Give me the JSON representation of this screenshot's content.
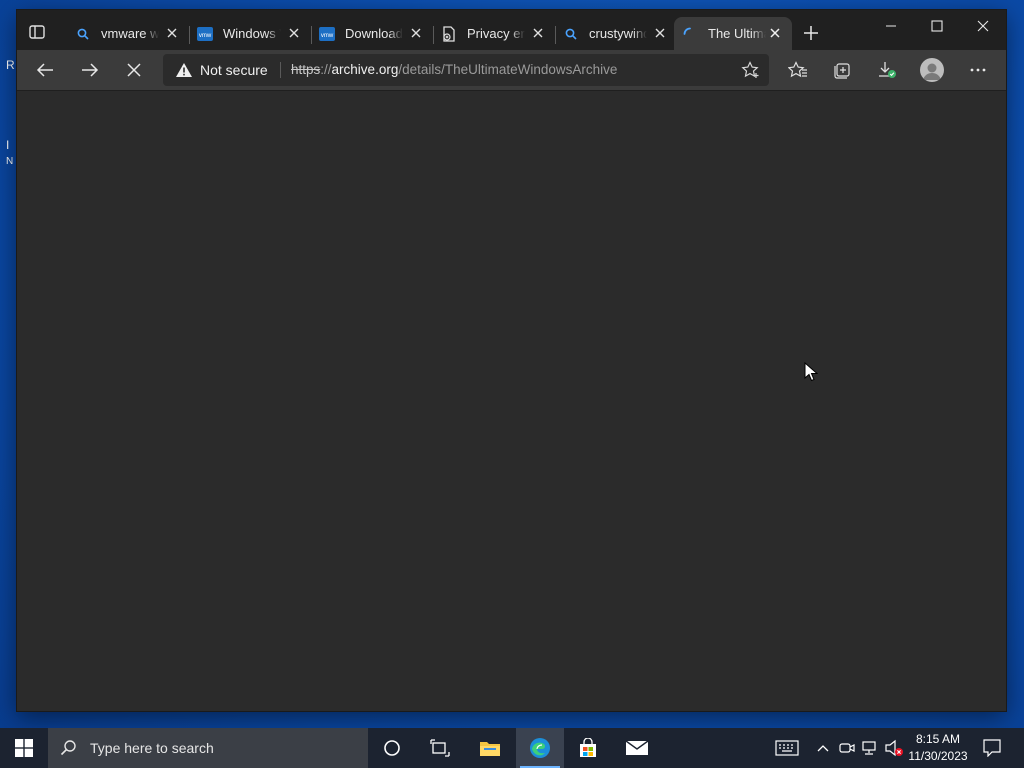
{
  "desktop": {
    "edge_letters": [
      "R",
      "I",
      "N"
    ]
  },
  "browser": {
    "tabs": [
      {
        "title": "vmware w",
        "favicon": "search-icon"
      },
      {
        "title": "Windows V",
        "favicon": "vmware-icon"
      },
      {
        "title": "Download",
        "favicon": "vmware-icon"
      },
      {
        "title": "Privacy err",
        "favicon": "privacy-error-icon"
      },
      {
        "title": "crustywind",
        "favicon": "search-icon"
      },
      {
        "title": "The Ultima",
        "favicon": "loading-spinner-icon"
      }
    ],
    "active_tab_index": 5,
    "address": {
      "security_label": "Not secure",
      "scheme": "https",
      "separator": "://",
      "host": "archive.org",
      "path": "/details/TheUltimateWindowsArchive"
    },
    "vmware_badge": "vmw"
  },
  "taskbar": {
    "search_placeholder": "Type here to search",
    "time": "8:15 AM",
    "date": "11/30/2023"
  },
  "colors": {
    "accent": "#4aa3ff",
    "content_bg": "#2b2b2b",
    "tabbar_bg": "#202020"
  }
}
